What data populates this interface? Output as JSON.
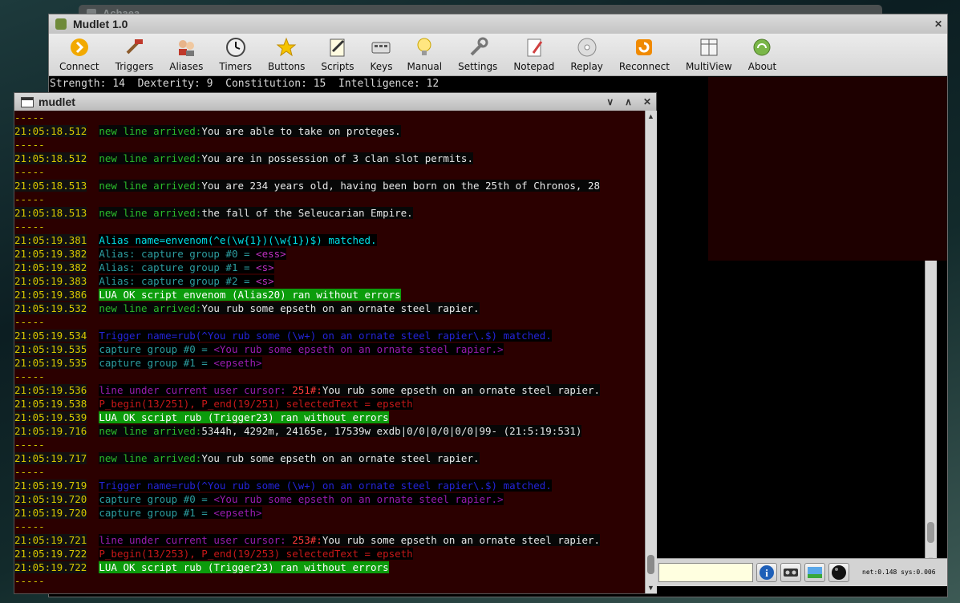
{
  "background_window": {
    "title": "Achaea"
  },
  "main_window": {
    "title": "Mudlet 1.0",
    "toolbar": [
      {
        "label": "Connect",
        "icon": "connect-icon"
      },
      {
        "label": "Triggers",
        "icon": "triggers-icon"
      },
      {
        "label": "Aliases",
        "icon": "aliases-icon"
      },
      {
        "label": "Timers",
        "icon": "timers-icon"
      },
      {
        "label": "Buttons",
        "icon": "buttons-icon"
      },
      {
        "label": "Scripts",
        "icon": "scripts-icon"
      },
      {
        "label": "Keys",
        "icon": "keys-icon"
      },
      {
        "label": "Manual",
        "icon": "manual-icon"
      },
      {
        "label": "Settings",
        "icon": "settings-icon"
      },
      {
        "label": "Notepad",
        "icon": "notepad-icon"
      },
      {
        "label": "Replay",
        "icon": "replay-icon"
      },
      {
        "label": "Reconnect",
        "icon": "reconnect-icon"
      },
      {
        "label": "MultiView",
        "icon": "multiview-icon"
      },
      {
        "label": "About",
        "icon": "about-icon"
      }
    ],
    "status_line": "Strength: 14  Dexterity: 9  Constitution: 15  Intelligence: 12",
    "net_status": "net:0.148 sys:0.006"
  },
  "mudlet_window": {
    "title": "mudlet",
    "lines": [
      {
        "sep": "-----"
      },
      {
        "ts": "21:05:18.512",
        "parts": [
          [
            "c-green",
            "new line arrived:"
          ],
          [
            "c-white",
            "You are able to take on proteges."
          ]
        ]
      },
      {
        "sep": "-----"
      },
      {
        "ts": "21:05:18.512",
        "parts": [
          [
            "c-green",
            "new line arrived:"
          ],
          [
            "c-white",
            "You are in possession of 3 clan slot permits."
          ]
        ]
      },
      {
        "sep": "-----"
      },
      {
        "ts": "21:05:18.513",
        "parts": [
          [
            "c-green",
            "new line arrived:"
          ],
          [
            "c-white",
            "You are 234 years old, having been born on the 25th of Chronos, 28"
          ]
        ]
      },
      {
        "sep": "-----"
      },
      {
        "ts": "21:05:18.513",
        "parts": [
          [
            "c-green",
            "new line arrived:"
          ],
          [
            "c-white",
            "the fall of the Seleucarian Empire."
          ]
        ]
      },
      {
        "sep": "-----"
      },
      {
        "ts": "21:05:19.381",
        "parts": [
          [
            "c-cyan",
            "Alias name=envenom(^e(\\w{1})(\\w{1})$) matched."
          ]
        ]
      },
      {
        "ts": "21:05:19.382",
        "parts": [
          [
            "c-teal",
            "Alias: capture group #0 = "
          ],
          [
            "c-magenta",
            "<ess>"
          ]
        ]
      },
      {
        "ts": "21:05:19.382",
        "parts": [
          [
            "c-teal",
            "Alias: capture group #1 = "
          ],
          [
            "c-magenta",
            "<s>"
          ]
        ]
      },
      {
        "ts": "21:05:19.383",
        "parts": [
          [
            "c-teal",
            "Alias: capture group #2 = "
          ],
          [
            "c-magenta",
            "<s>"
          ]
        ]
      },
      {
        "ts": "21:05:19.386",
        "parts": [
          [
            "c-okgreen",
            "LUA OK script envenom (Alias20) ran without errors"
          ]
        ]
      },
      {
        "ts": "21:05:19.532",
        "parts": [
          [
            "c-green",
            "new line arrived:"
          ],
          [
            "c-white",
            "You rub some epseth on an ornate steel rapier."
          ]
        ]
      },
      {
        "sep": "-----"
      },
      {
        "ts": "21:05:19.534",
        "parts": [
          [
            "c-blue",
            "Trigger name=rub(^You rub some (\\w+) on an ornate steel rapier\\.$) matched."
          ]
        ]
      },
      {
        "ts": "21:05:19.535",
        "parts": [
          [
            "c-teal",
            "capture group #0 = "
          ],
          [
            "c-purple",
            "<You rub some epseth on an ornate steel rapier.>"
          ]
        ]
      },
      {
        "ts": "21:05:19.535",
        "parts": [
          [
            "c-teal",
            "capture group #1 = "
          ],
          [
            "c-purple",
            "<epseth>"
          ]
        ]
      },
      {
        "sep": "-----"
      },
      {
        "ts": "21:05:19.536",
        "parts": [
          [
            "c-purple",
            "line under current user cursor: "
          ],
          [
            "c-red",
            "251#:"
          ],
          [
            "c-white",
            "You rub some epseth on an ornate steel rapier."
          ]
        ]
      },
      {
        "ts": "21:05:19.538",
        "parts": [
          [
            "c-darkred",
            "P_begin(13/251), P_end(19/251) selectedText = epseth"
          ]
        ]
      },
      {
        "ts": "21:05:19.539",
        "parts": [
          [
            "c-okgreen",
            "LUA OK script rub (Trigger23) ran without errors"
          ]
        ]
      },
      {
        "ts": "21:05:19.716",
        "parts": [
          [
            "c-green",
            "new line arrived:"
          ],
          [
            "c-white",
            "5344h, 4292m, 24165e, 17539w exdb|0/0|0/0|0/0|99- (21:5:19:531)"
          ]
        ]
      },
      {
        "sep": "-----"
      },
      {
        "ts": "21:05:19.717",
        "parts": [
          [
            "c-green",
            "new line arrived:"
          ],
          [
            "c-white",
            "You rub some epseth on an ornate steel rapier."
          ]
        ]
      },
      {
        "sep": "-----"
      },
      {
        "ts": "21:05:19.719",
        "parts": [
          [
            "c-blue",
            "Trigger name=rub(^You rub some (\\w+) on an ornate steel rapier\\.$) matched."
          ]
        ]
      },
      {
        "ts": "21:05:19.720",
        "parts": [
          [
            "c-teal",
            "capture group #0 = "
          ],
          [
            "c-purple",
            "<You rub some epseth on an ornate steel rapier.>"
          ]
        ]
      },
      {
        "ts": "21:05:19.720",
        "parts": [
          [
            "c-teal",
            "capture group #1 = "
          ],
          [
            "c-purple",
            "<epseth>"
          ]
        ]
      },
      {
        "sep": "-----"
      },
      {
        "ts": "21:05:19.721",
        "parts": [
          [
            "c-purple",
            "line under current user cursor: "
          ],
          [
            "c-red",
            "253#:"
          ],
          [
            "c-white",
            "You rub some epseth on an ornate steel rapier."
          ]
        ]
      },
      {
        "ts": "21:05:19.722",
        "parts": [
          [
            "c-darkred",
            "P_begin(13/253), P_end(19/253) selectedText = epseth"
          ]
        ]
      },
      {
        "ts": "21:05:19.722",
        "parts": [
          [
            "c-okgreen",
            "LUA OK script rub (Trigger23) ran without errors"
          ]
        ]
      },
      {
        "sep": "-----"
      }
    ]
  }
}
